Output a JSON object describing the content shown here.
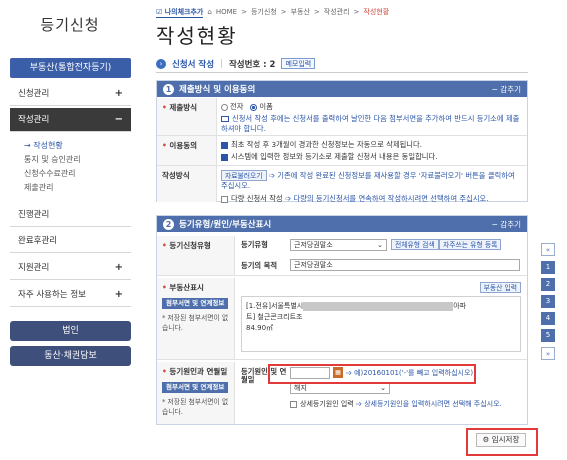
{
  "sidebar": {
    "title": "등기신청",
    "head": "부동산(통합전자등기)",
    "items": [
      {
        "label": "신청관리",
        "plus": "+"
      },
      {
        "label": "작성관리",
        "plus": "−"
      },
      {
        "label": "진행관리",
        "plus": ""
      },
      {
        "label": "완료후관리",
        "plus": ""
      },
      {
        "label": "지원관리",
        "plus": "+"
      },
      {
        "label": "자주 사용하는 정보",
        "plus": "+"
      }
    ],
    "subitems": [
      "작성현황",
      "통지 및 승인관리",
      "신청수수료관리",
      "제출관리"
    ],
    "btn_corp": "법인",
    "btn_movable": "동산·채권담보"
  },
  "crumb": {
    "check": "나의체크추가",
    "items": [
      "HOME",
      "등기신청",
      "부동산",
      "작성관리"
    ],
    "current": "작성현황"
  },
  "page_title": "작성현황",
  "subbar": {
    "label": "신청서 작성",
    "sep": "|",
    "number_label": "작성번호 : 2",
    "memo_btn": "메모입력"
  },
  "section1": {
    "number": "1",
    "title": "제출방식 및 이용동의",
    "collapse": "− 감추기",
    "submit_label": "제출방식",
    "submit_opt1": "전자",
    "submit_opt2": "이폼",
    "submit_note": "신청서 작성 후에는 신청서를 출력하여 날인한 다음 첨부서면을 추가하여 반드시 등기소에 제출하셔야 합니다.",
    "agree_label": "이용동의",
    "agree1": "최초 작성 후 3개월이 경과한 신청정보는 자동으로 삭제됩니다.",
    "agree2": "시스템에 입력한 정보와 등기소로 제출할 신청서 내용은 동일합니다.",
    "method_label": "작성방식",
    "method_btn": "자료불러오기",
    "method_note": "기존에 작성 완료된 신청정보를 재사용할 경우 '자료불러오기' 버튼을 클릭하여 주십시오.",
    "method_multi": "다량 신청서 작성",
    "method_multi_note": "다량의 등기신청서를 연속하여 작성하시려면 선택하여 주십시오."
  },
  "section2": {
    "number": "2",
    "title": "등기유형/원인/부동산표시",
    "collapse": "− 감추기",
    "type_label": "등기신청유형",
    "type_field_label": "등기유형",
    "type_value": "근저당권말소",
    "type_btn1": "전체유형 검색",
    "type_btn2": "자주쓰는 유형 등록",
    "purpose_label": "등기의 목적",
    "purpose_value": "근저당권말소",
    "estate_label": "부동산표시",
    "estate_input_btn": "부동산 입력",
    "estate_attach_btn": "첨부서면 및 연계정보",
    "estate_attach_note": "* 저장된 첨부서면이 없습니다.",
    "estate_line1_prefix": "[1.전유]서울특별시",
    "estate_line1_suffix": "아파",
    "estate_line2": "트] 철근콘크리트조",
    "estate_line3": "84.90㎡",
    "cause_label": "등기원인과 연월일",
    "cause_attach_btn": "첨부서면 및 연계정보",
    "cause_attach_note": "* 저장된 첨부서면이 없습니다.",
    "cause_date_label": "등기원인 및 연월일",
    "cause_date_hint": "예)20160101('-'를 빼고 입력하십시오)",
    "cause_value": "해지",
    "cause_detail": "상세등기원인 입력",
    "cause_detail_note": "상세등기원인을 입력하시려면 선택해 주십시오."
  },
  "rnav": [
    "«",
    "1",
    "2",
    "3",
    "4",
    "5",
    "»"
  ],
  "save_btn": "임시저장",
  "colors": {
    "primary": "#4e6fab",
    "highlight": "#e23a3a",
    "sidebar_head": "#3b5ea8"
  }
}
